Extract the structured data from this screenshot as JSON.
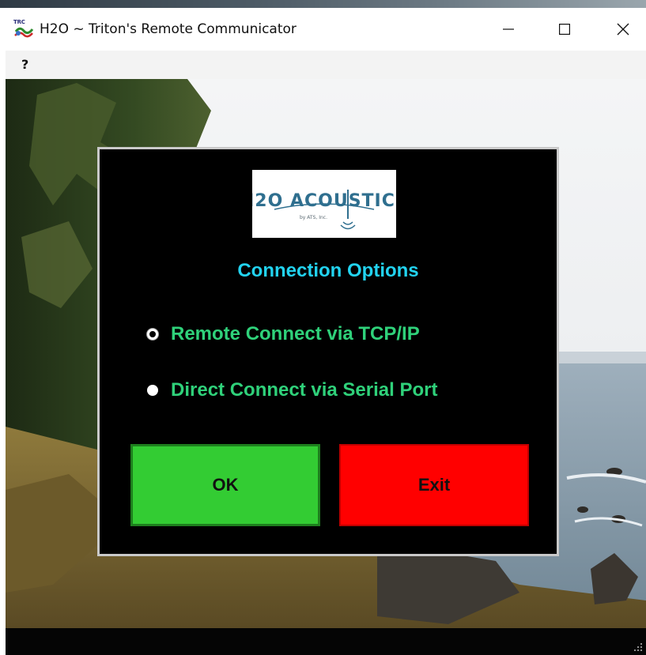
{
  "window": {
    "icon_badge": "TRC",
    "title": "H2O ~ Triton's Remote Communicator",
    "minimize_label": "—",
    "maximize_label": "☐",
    "close_label": "✕"
  },
  "menu": {
    "items": [
      "?"
    ]
  },
  "dialog": {
    "logo_alt": "H2O Acoustics by ATS, Inc.",
    "heading": "Connection Options",
    "options": [
      {
        "label": "Remote Connect via TCP/IP",
        "selected": true
      },
      {
        "label": "Direct Connect via Serial Port",
        "selected": false
      }
    ],
    "ok_label": "OK",
    "exit_label": "Exit"
  },
  "colors": {
    "heading": "#22d3f0",
    "option_text": "#2fd17a",
    "ok_button": "#33cc33",
    "exit_button": "#ff0000",
    "dialog_bg": "#000000"
  }
}
